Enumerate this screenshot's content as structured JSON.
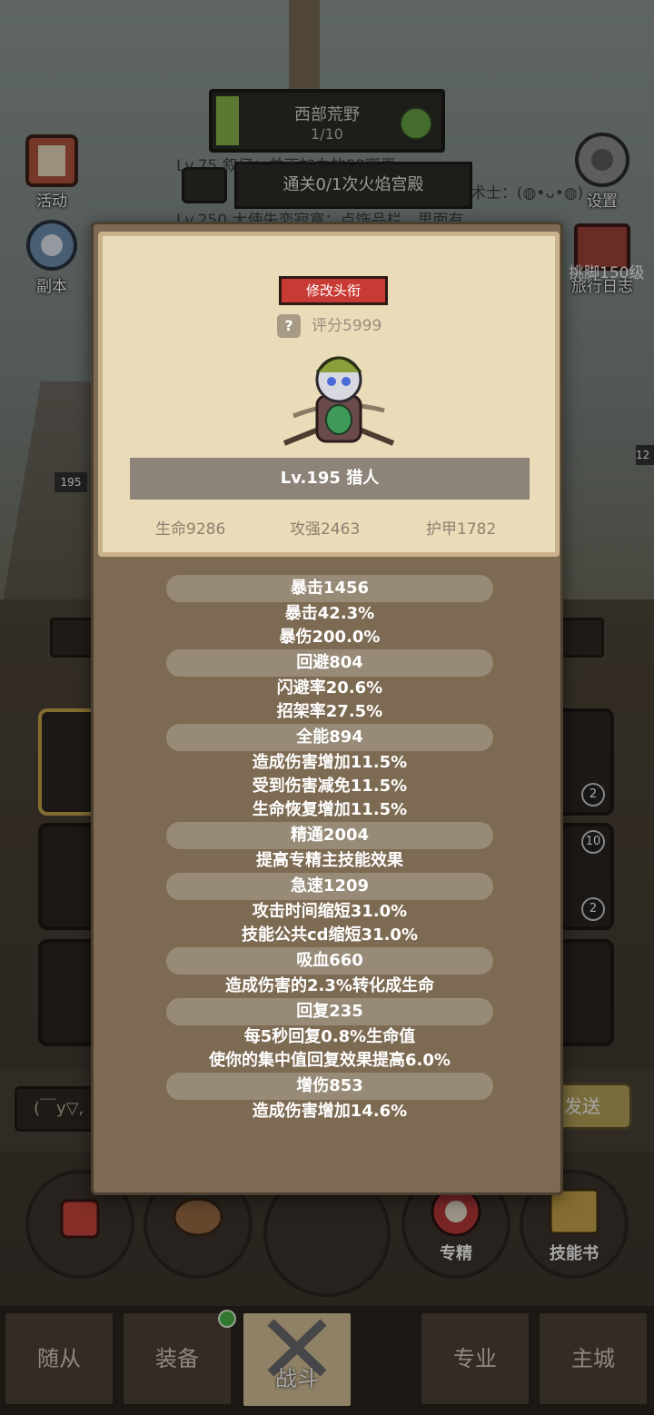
{
  "zone": {
    "name": "西部荒野",
    "progress_text": "1/10",
    "progress": 0.1
  },
  "quest": {
    "text": "通关0/1次火焰宫殿"
  },
  "feed": [
    "Lv.75 叙仔：羊不加血的SP哪弄",
    "Lv.3 术士：(◍•ᴗ•◍)",
    "Lv.250 大使失恋寂寞：点饰品栏，里面有"
  ],
  "left_buttons": [
    {
      "label": "活动"
    },
    {
      "label": "副本"
    }
  ],
  "right_buttons": [
    {
      "label": "设置"
    },
    {
      "label": "旅行日志"
    }
  ],
  "right_overlay_text": "挑脚150级",
  "level_badge": "195",
  "right_level_badge": "12",
  "slots": {
    "count_a": "2",
    "count_b": "10",
    "count_c": "2"
  },
  "chat": {
    "input_text": "(￣y▽,",
    "send_label": "发送"
  },
  "actions": [
    {
      "label": ""
    },
    {
      "label": ""
    },
    {
      "label": ""
    },
    {
      "label": "专精"
    },
    {
      "label": "技能书"
    }
  ],
  "tabs": [
    {
      "label": "随从"
    },
    {
      "label": "装备"
    },
    {
      "label": "战斗"
    },
    {
      "label": "专业"
    },
    {
      "label": "主城"
    }
  ],
  "popup": {
    "change_title_label": "修改头衔",
    "help_symbol": "?",
    "score": "评分5999",
    "name": "Lv.195 猎人",
    "hp": "生命9286",
    "attack": "攻强2463",
    "armor": "护甲1782",
    "groups": [
      {
        "head": "暴击1456",
        "lines": [
          "暴击42.3%",
          "暴伤200.0%"
        ]
      },
      {
        "head": "回避804",
        "lines": [
          "闪避率20.6%",
          "招架率27.5%"
        ]
      },
      {
        "head": "全能894",
        "lines": [
          "造成伤害增加11.5%",
          "受到伤害减免11.5%",
          "生命恢复增加11.5%"
        ]
      },
      {
        "head": "精通2004",
        "lines": [
          "提高专精主技能效果"
        ]
      },
      {
        "head": "急速1209",
        "lines": [
          "攻击时间缩短31.0%",
          "技能公共cd缩短31.0%"
        ]
      },
      {
        "head": "吸血660",
        "lines": [
          "造成伤害的2.3%转化成生命"
        ]
      },
      {
        "head": "回复235",
        "lines": [
          "每5秒回复0.8%生命值",
          "使你的集中值回复效果提高6.0%"
        ]
      },
      {
        "head": "增伤853",
        "lines": [
          "造成伤害增加14.6%"
        ]
      }
    ]
  }
}
